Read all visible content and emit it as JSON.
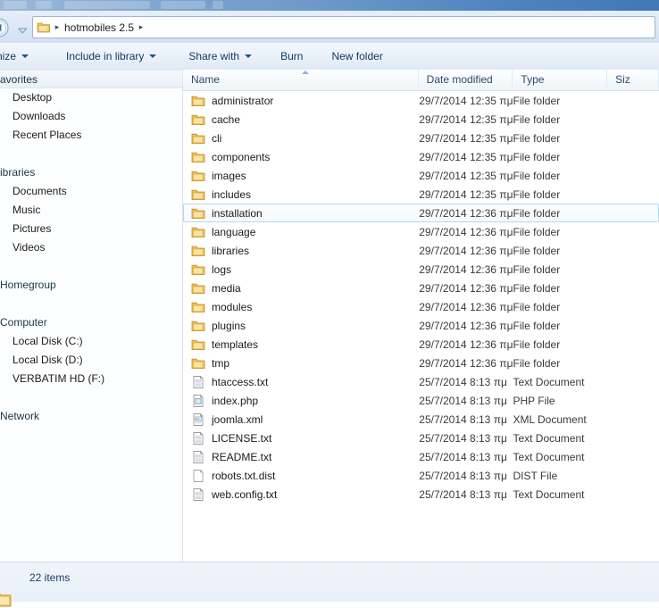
{
  "window": {
    "title_strip": "",
    "accent_blue": "#4079b8",
    "folder_yellow": "#fcd77f",
    "chrome_blue": "#d3e1f2"
  },
  "addressbar": {
    "back_icon": "back-arrow-icon",
    "dropdown_icon": "chevron-down-icon",
    "folder_icon": "folder-icon",
    "separator": "▸",
    "crumbs": [
      "hotmobiles 2.5"
    ]
  },
  "toolbar": {
    "items": [
      {
        "label": "nize",
        "caret": true,
        "clipped": true
      },
      {
        "label": "Include in library",
        "caret": true,
        "clipped": false
      },
      {
        "label": "Share with",
        "caret": true,
        "clipped": false
      },
      {
        "label": "Burn",
        "caret": false,
        "clipped": false
      },
      {
        "label": "New folder",
        "caret": false,
        "clipped": false
      }
    ]
  },
  "sidebar": {
    "groups": [
      {
        "header": "avorites",
        "highlighted": true,
        "children": [
          "Desktop",
          "Downloads",
          "Recent Places"
        ]
      },
      {
        "header": "ibraries",
        "highlighted": false,
        "children": [
          "Documents",
          "Music",
          "Pictures",
          "Videos"
        ]
      },
      {
        "header": "Homegroup",
        "highlighted": false,
        "children": []
      },
      {
        "header": "Computer",
        "highlighted": false,
        "children": [
          "Local Disk (C:)",
          "Local Disk (D:)",
          "VERBATIM HD (F:)"
        ]
      },
      {
        "header": "Network",
        "highlighted": false,
        "children": []
      }
    ]
  },
  "filelist": {
    "columns": [
      {
        "label": "Name",
        "sorted": "asc"
      },
      {
        "label": "Date modified",
        "sorted": ""
      },
      {
        "label": "Type",
        "sorted": ""
      },
      {
        "label": "Siz",
        "sorted": ""
      }
    ],
    "rows": [
      {
        "name": "administrator",
        "date": "29/7/2014 12:35 πμ",
        "type": "File folder",
        "size": "",
        "icon": "folder-icon",
        "focused": false
      },
      {
        "name": "cache",
        "date": "29/7/2014 12:35 πμ",
        "type": "File folder",
        "size": "",
        "icon": "folder-icon",
        "focused": false
      },
      {
        "name": "cli",
        "date": "29/7/2014 12:35 πμ",
        "type": "File folder",
        "size": "",
        "icon": "folder-icon",
        "focused": false
      },
      {
        "name": "components",
        "date": "29/7/2014 12:35 πμ",
        "type": "File folder",
        "size": "",
        "icon": "folder-icon",
        "focused": false
      },
      {
        "name": "images",
        "date": "29/7/2014 12:35 πμ",
        "type": "File folder",
        "size": "",
        "icon": "folder-icon",
        "focused": false
      },
      {
        "name": "includes",
        "date": "29/7/2014 12:35 πμ",
        "type": "File folder",
        "size": "",
        "icon": "folder-icon",
        "focused": false
      },
      {
        "name": "installation",
        "date": "29/7/2014 12:36 πμ",
        "type": "File folder",
        "size": "",
        "icon": "folder-icon",
        "focused": true
      },
      {
        "name": "language",
        "date": "29/7/2014 12:36 πμ",
        "type": "File folder",
        "size": "",
        "icon": "folder-icon",
        "focused": false
      },
      {
        "name": "libraries",
        "date": "29/7/2014 12:36 πμ",
        "type": "File folder",
        "size": "",
        "icon": "folder-icon",
        "focused": false
      },
      {
        "name": "logs",
        "date": "29/7/2014 12:36 πμ",
        "type": "File folder",
        "size": "",
        "icon": "folder-icon",
        "focused": false
      },
      {
        "name": "media",
        "date": "29/7/2014 12:36 πμ",
        "type": "File folder",
        "size": "",
        "icon": "folder-icon",
        "focused": false
      },
      {
        "name": "modules",
        "date": "29/7/2014 12:36 πμ",
        "type": "File folder",
        "size": "",
        "icon": "folder-icon",
        "focused": false
      },
      {
        "name": "plugins",
        "date": "29/7/2014 12:36 πμ",
        "type": "File folder",
        "size": "",
        "icon": "folder-icon",
        "focused": false
      },
      {
        "name": "templates",
        "date": "29/7/2014 12:36 πμ",
        "type": "File folder",
        "size": "",
        "icon": "folder-icon",
        "focused": false
      },
      {
        "name": "tmp",
        "date": "29/7/2014 12:36 πμ",
        "type": "File folder",
        "size": "",
        "icon": "folder-icon",
        "focused": false
      },
      {
        "name": "htaccess.txt",
        "date": "25/7/2014 8:13 πμ",
        "type": "Text Document",
        "size": "",
        "icon": "text-file-icon",
        "focused": false
      },
      {
        "name": "index.php",
        "date": "25/7/2014 8:13 πμ",
        "type": "PHP File",
        "size": "",
        "icon": "php-file-icon",
        "focused": false
      },
      {
        "name": "joomla.xml",
        "date": "25/7/2014 8:13 πμ",
        "type": "XML Document",
        "size": "",
        "icon": "xml-file-icon",
        "focused": false
      },
      {
        "name": "LICENSE.txt",
        "date": "25/7/2014 8:13 πμ",
        "type": "Text Document",
        "size": "",
        "icon": "text-file-icon",
        "focused": false
      },
      {
        "name": "README.txt",
        "date": "25/7/2014 8:13 πμ",
        "type": "Text Document",
        "size": "",
        "icon": "text-file-icon",
        "focused": false
      },
      {
        "name": "robots.txt.dist",
        "date": "25/7/2014 8:13 πμ",
        "type": "DIST File",
        "size": "",
        "icon": "blank-file-icon",
        "focused": false
      },
      {
        "name": "web.config.txt",
        "date": "25/7/2014 8:13 πμ",
        "type": "Text Document",
        "size": "",
        "icon": "text-file-icon",
        "focused": false
      }
    ]
  },
  "statusbar": {
    "item_count": "22 items",
    "folder_icon": "folder-icon"
  }
}
